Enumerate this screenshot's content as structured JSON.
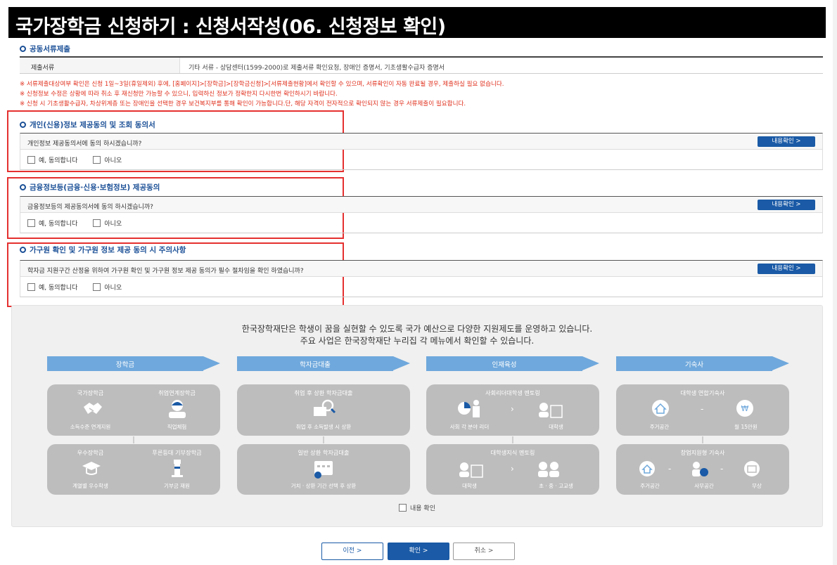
{
  "page": {
    "title": "국가장학금 신청하기 : 신청서작성(06. 신청정보 확인)"
  },
  "documents": {
    "section_title": "공동서류제출",
    "label": "제출서류",
    "value": "기타 서류 - 상담센터(1599-2000)로 제출서류 확인요청, 장애인 증명서, 기초생활수급자 증명서"
  },
  "notices": [
    "※ 서류제출대상여부 확인은 신청 1일~3일(휴일제외) 후에, [홈페이지]>[장학금]>[장학금신청]>[서류제출현황]에서 확인할 수 있으며, 서류확인이 자동 완료될 경우, 제출하실 필요 없습니다.",
    "※ 신청정보 수정은 상황에 따라 취소 후 재신청만 가능할 수 있으니, 입력하신 정보가 정확한지 다시한번 확인하시기 바랍니다.",
    "※ 신청 시 기초생활수급자, 차상위계층 또는 장애인을 선택한 경우 보건복지부를 통해 확인이 가능합니다.단, 해당 자격이 전자적으로 확인되지 않는 경우 서류제출이 필요합니다."
  ],
  "agreements": [
    {
      "title": "개인(신용)정보 제공동의 및 조회 동의서",
      "question": "개인정보 제공동의서에 동의 하시겠습니까?",
      "view_label": "내용확인 >",
      "yes_label": "예, 동의합니다",
      "no_label": "아니오"
    },
    {
      "title": "금융정보등(금융·신용·보험정보) 제공동의",
      "question": "금융정보등의 제공동의서에 동의 하시겠습니까?",
      "view_label": "내용확인 >",
      "yes_label": "예, 동의합니다",
      "no_label": "아니오"
    },
    {
      "title": "가구원 확인 및 가구원 정보 제공 동의 시 주의사항",
      "question": "학자금 지원구간 산정을 위하여 가구원 확인 및 가구원 정보 제공 동의가 필수 절차임을 확인 하였습니까?",
      "view_label": "내용확인 >",
      "yes_label": "예, 동의합니다",
      "no_label": "아니오"
    }
  ],
  "info": {
    "intro_line1": "한국장학재단은 학생이 꿈을 실현할 수 있도록 국가 예산으로 다양한 지원제도를 운영하고 있습니다.",
    "intro_line2": "주요 사업은 한국장학재단 누리집 각 메뉴에서 확인할 수 있습니다.",
    "categories": [
      "장학금",
      "학자금대출",
      "인재육성",
      "기숙사"
    ],
    "scholarship": {
      "card1_left_title": "국가장학금",
      "card1_right_title": "취업연계장학금",
      "card1_left_cap": "소득수준 연계지원",
      "card1_right_cap": "직업체험",
      "card2_left_title": "우수장학금",
      "card2_right_title": "푸른등대 기부장학금",
      "card2_left_cap": "계열별 우수학생",
      "card2_right_cap": "기부금 재원"
    },
    "loan": {
      "card1_title": "취업 후 상환 학자금대출",
      "card1_cap": "취업 후 소득발생 시 상환",
      "card2_title": "일반 상환 학자금대출",
      "card2_cap": "거치 · 상환 기간 선택 후 상환"
    },
    "talent": {
      "card1_title": "사회리더대학생 멘토링",
      "card1_left_cap": "사회 각 분야 리더",
      "card1_right_cap": "대학생",
      "card2_title": "대학생지식 멘토링",
      "card2_left_cap": "대학생",
      "card2_right_cap": "초 · 중 · 고교생"
    },
    "dorm": {
      "card1_title": "대학생 연합기숙사",
      "card1_left_cap": "주거공간",
      "card1_right_cap": "월 15만원",
      "card2_title": "창업지원형 기숙사",
      "card2_cap1": "주거공간",
      "card2_cap2": "사무공간",
      "card2_cap3": "무상"
    },
    "confirm_label": "내용 확인"
  },
  "footer": {
    "prev_label": "이전  >",
    "ok_label": "확인  >",
    "cancel_label": "취소  >"
  },
  "colors": {
    "title_bg": "#000000",
    "accent_blue": "#1a5aa6",
    "notice_red": "#e0301e",
    "highlight_frame": "#e53030",
    "category_arrow": "#6fa8dc",
    "card_gray": "#bdbdbd"
  }
}
